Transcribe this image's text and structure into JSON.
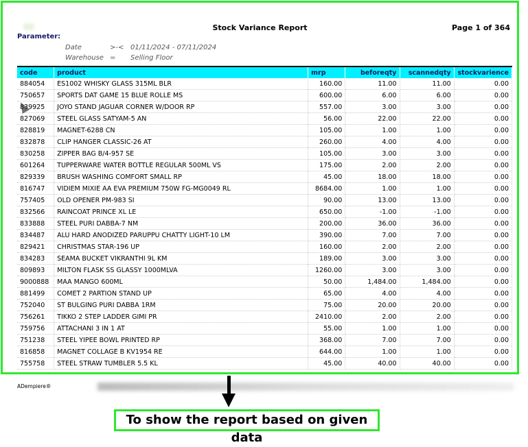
{
  "report": {
    "title": "Stock Variance Report",
    "page": "Page 1 of 364",
    "parameter_label": "Parameter:",
    "params": [
      {
        "label": "Date",
        "op": ">-<",
        "value": "01/11/2024 - 07/11/2024"
      },
      {
        "label": "Warehouse",
        "op": "=",
        "value": "Selling Floor"
      }
    ],
    "columns": [
      "code",
      "product",
      "mrp",
      "beforeqty",
      "scannedqty",
      "stockvarience"
    ],
    "rows": [
      [
        "884054",
        "ES1002 WHISKY GLASS 315ML BLR",
        "160.00",
        "11.00",
        "11.00",
        "0.00"
      ],
      [
        "750657",
        "SPORTS DAT GAME 15 BLUE ROLLE MS",
        "600.00",
        "6.00",
        "6.00",
        "0.00"
      ],
      [
        "839925",
        "JOYO STAND JAGUAR CORNER W/DOOR RP",
        "557.00",
        "3.00",
        "3.00",
        "0.00"
      ],
      [
        "827069",
        "STEEL GLASS SATYAM-5 AN",
        "56.00",
        "22.00",
        "22.00",
        "0.00"
      ],
      [
        "828819",
        "MAGNET-6288 CN",
        "105.00",
        "1.00",
        "1.00",
        "0.00"
      ],
      [
        "832878",
        "CLIP HANGER CLASSIC-26 AT",
        "260.00",
        "4.00",
        "4.00",
        "0.00"
      ],
      [
        "830258",
        "ZIPPER BAG B/4-957 SE",
        "105.00",
        "3.00",
        "3.00",
        "0.00"
      ],
      [
        "601264",
        "TUPPERWARE WATER BOTTLE REGULAR 500ML VS",
        "175.00",
        "2.00",
        "2.00",
        "0.00"
      ],
      [
        "829339",
        "BRUSH WASHING COMFORT SMALL RP",
        "45.00",
        "18.00",
        "18.00",
        "0.00"
      ],
      [
        "816747",
        "VIDIEM MIXIE AA EVA PREMIUM 750W FG-MG0049 RL",
        "8684.00",
        "1.00",
        "1.00",
        "0.00"
      ],
      [
        "757405",
        "OLD OPENER PM-983 SI",
        "90.00",
        "13.00",
        "13.00",
        "0.00"
      ],
      [
        "832566",
        "RAINCOAT PRINCE XL LE",
        "650.00",
        "-1.00",
        "-1.00",
        "0.00"
      ],
      [
        "833888",
        "STEEL PURI DABBA-7 NM",
        "200.00",
        "36.00",
        "36.00",
        "0.00"
      ],
      [
        "834487",
        "ALU HARD ANODIZED PARUPPU CHATTY LIGHT-10 LM",
        "390.00",
        "7.00",
        "7.00",
        "0.00"
      ],
      [
        "829421",
        "CHRISTMAS STAR-196 UP",
        "160.00",
        "2.00",
        "2.00",
        "0.00"
      ],
      [
        "834283",
        "SEAMA BUCKET VIKRANTHI 9L KM",
        "189.00",
        "3.00",
        "3.00",
        "0.00"
      ],
      [
        "809893",
        "MILTON FLASK SS GLASSY 1000MLVA",
        "1260.00",
        "3.00",
        "3.00",
        "0.00"
      ],
      [
        "9000888",
        "MAA MANGO 600ML",
        "50.00",
        "1,484.00",
        "1,484.00",
        "0.00"
      ],
      [
        "881499",
        "COMET 2 PARTION STAND UP",
        "65.00",
        "4.00",
        "4.00",
        "0.00"
      ],
      [
        "752040",
        "ST BULGING PURI DABBA 1RM",
        "75.00",
        "20.00",
        "20.00",
        "0.00"
      ],
      [
        "756261",
        "TIKKO 2 STEP LADDER GIMI PR",
        "2410.00",
        "2.00",
        "2.00",
        "0.00"
      ],
      [
        "759756",
        "ATTACHANI 3 IN 1 AT",
        "55.00",
        "1.00",
        "1.00",
        "0.00"
      ],
      [
        "751238",
        "STEEL YIPEE BOWL PRINTED RP",
        "368.00",
        "7.00",
        "7.00",
        "0.00"
      ],
      [
        "816858",
        "MAGNET COLLAGE B KV1954 RE",
        "644.00",
        "1.00",
        "1.00",
        "0.00"
      ],
      [
        "755758",
        "STEEL STRAW TUMBLER 5.5 KL",
        "45.00",
        "40.00",
        "40.00",
        "0.00"
      ]
    ],
    "footer": "ADempiere®"
  },
  "caption": "To show the report based on given data",
  "colors": {
    "highlight": "#2ee82e",
    "header_bg": "#00f0ff",
    "header_text": "#1a1a66"
  }
}
